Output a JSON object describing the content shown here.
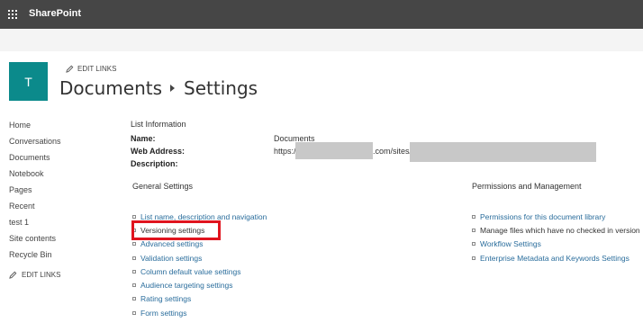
{
  "suitebar": {
    "app_name": "SharePoint",
    "launcher_icon": "waffle-icon"
  },
  "site": {
    "tile_letter": "T",
    "edit_links_top": "EDIT LINKS"
  },
  "title": {
    "part1": "Documents",
    "part2": "Settings"
  },
  "left_nav": {
    "items": [
      "Home",
      "Conversations",
      "Documents",
      "Notebook",
      "Pages",
      "Recent",
      "test 1",
      "Site contents",
      "Recycle Bin"
    ],
    "edit_links": "EDIT LINKS"
  },
  "list_info": {
    "header": "List Information",
    "name_label": "Name:",
    "name_value": "Documents",
    "web_address_label": "Web Address:",
    "web_address_prefix": "https:/",
    "web_address_mid": ".com/sites/",
    "description_label": "Description:"
  },
  "general_settings": {
    "header": "General Settings",
    "links": [
      "List name, description and navigation",
      "Versioning settings",
      "Advanced settings",
      "Validation settings",
      "Column default value settings",
      "Audience targeting settings",
      "Rating settings",
      "Form settings"
    ]
  },
  "permissions": {
    "header": "Permissions and Management",
    "links": [
      "Permissions for this document library",
      "Manage files which have no checked in version",
      "Workflow Settings",
      "Enterprise Metadata and Keywords Settings"
    ]
  },
  "colors": {
    "suitebar": "#464646",
    "tile": "#0b8a8b",
    "link": "#2a6d9c",
    "highlight": "#e0141e"
  }
}
